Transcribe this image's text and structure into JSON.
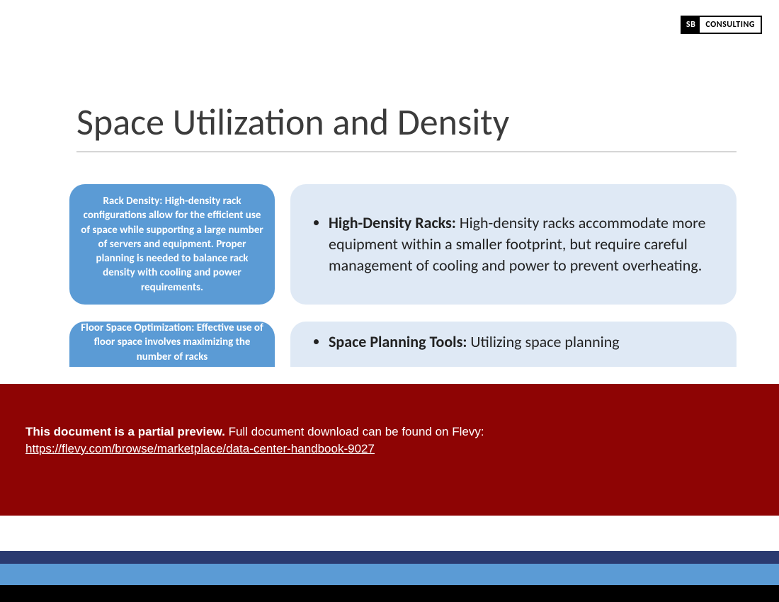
{
  "logo": {
    "sb": "SB",
    "consulting": "CONSULTING"
  },
  "title": "Space Utilization and Density",
  "rows": [
    {
      "pill": "Rack Density: High-density rack configurations allow for the efficient use of space while supporting a large number of servers and equipment. Proper planning is needed to balance rack density with cooling and power requirements.",
      "bullet_heading": "High-Density Racks:",
      "bullet_body": " High-density racks accommodate more equipment within a smaller footprint, but require careful management of cooling and power to prevent overheating."
    },
    {
      "pill": "Floor Space Optimization: Effective use of floor space involves maximizing the number of racks",
      "bullet_heading": "Space Planning Tools:",
      "bullet_body": " Utilizing space planning"
    }
  ],
  "overlay": {
    "prefix_bold": "This document is a partial preview.",
    "suffix": "  Full document download can be found on Flevy:",
    "link": "https://flevy.com/browse/marketplace/data-center-handbook-9027"
  }
}
